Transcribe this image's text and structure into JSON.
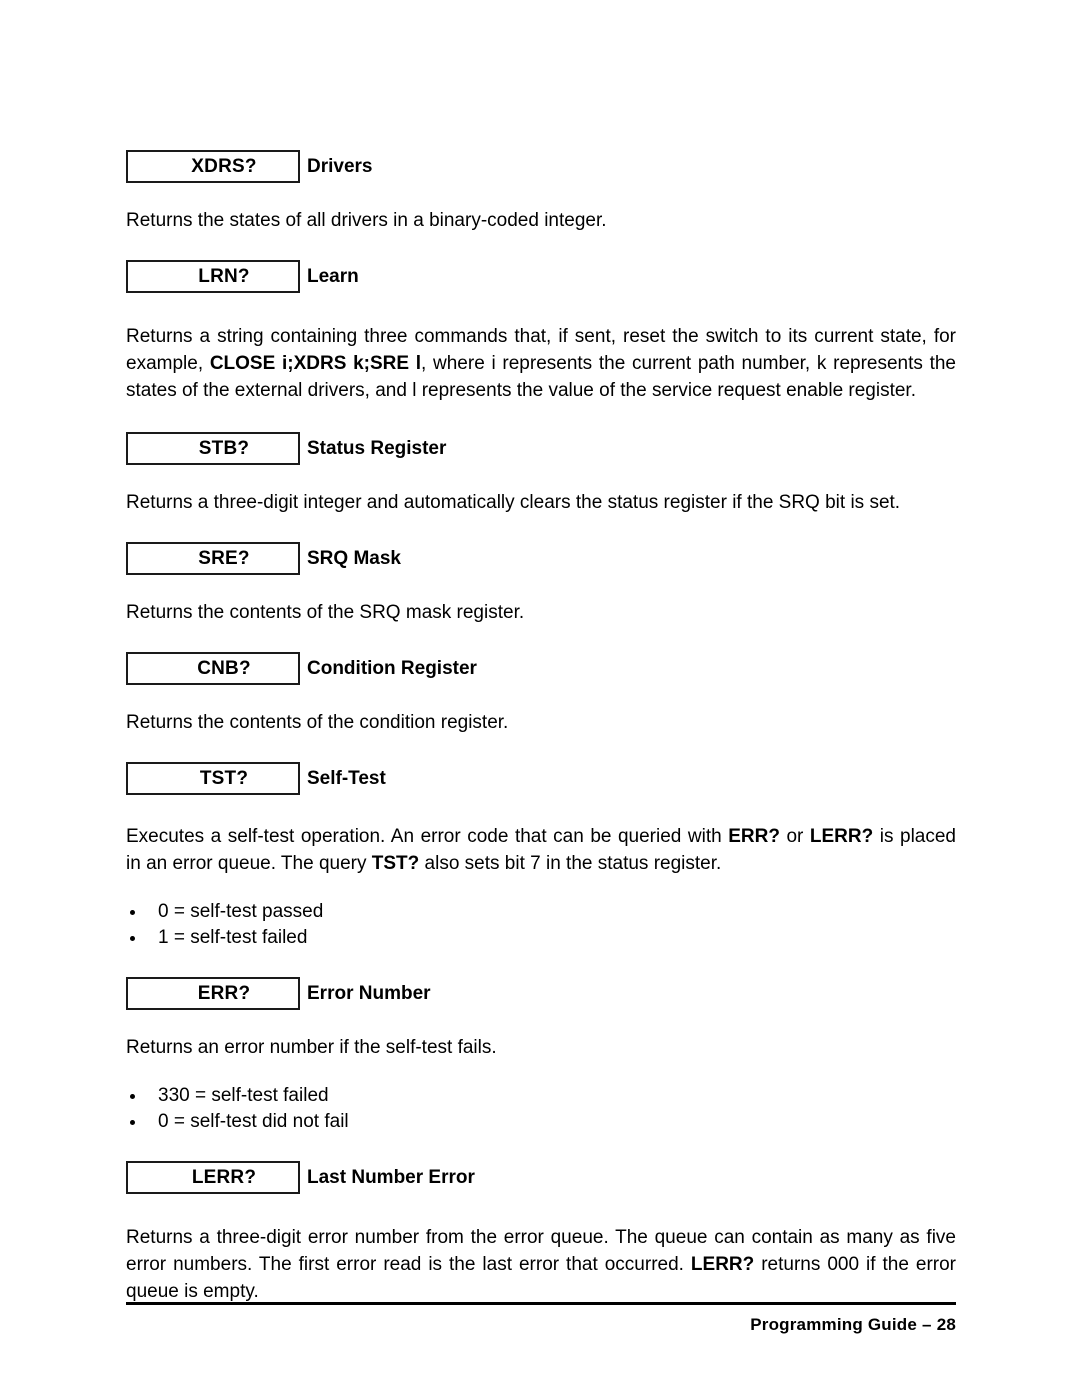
{
  "document": {
    "sections": [
      {
        "command": "XDRS?",
        "title": "Drivers",
        "paragraph": "Returns the states of all drivers in a binary-coded integer."
      },
      {
        "command": "LRN?",
        "title": "Learn",
        "paragraph_part1": "Returns a string containing three commands that, if sent, reset the switch to its current state, for example, ",
        "paragraph_bold": "CLOSE i;XDRS k;SRE l",
        "paragraph_part2": ", where i represents the current path number, k represents the states of the external drivers, and l represents the value of the service request enable register."
      },
      {
        "command": "STB?",
        "title": "Status Register",
        "paragraph": "Returns a three-digit integer and automatically clears the status register if the SRQ bit is set."
      },
      {
        "command": "SRE?",
        "title": "SRQ Mask",
        "paragraph": "Returns the contents of the SRQ mask register."
      },
      {
        "command": "CNB?",
        "title": "Condition Register",
        "paragraph": "Returns the contents of the condition register."
      },
      {
        "command": "TST?",
        "title": "Self-Test",
        "paragraph_part1": "Executes a self-test operation. An error code that can be queried with ",
        "paragraph_bold1": "ERR?",
        "paragraph_part2": " or ",
        "paragraph_bold2": "LERR?",
        "paragraph_part3": " is placed in an error queue. The query ",
        "paragraph_bold3": "TST?",
        "paragraph_part4": " also sets bit 7 in the status register.",
        "bullets": [
          "0 = self-test passed",
          "1 = self-test failed"
        ]
      },
      {
        "command": "ERR?",
        "title": "Error Number",
        "paragraph": "Returns an error number if the self-test fails.",
        "bullets": [
          "330 = self-test failed",
          "0 = self-test did not fail"
        ]
      },
      {
        "command": "LERR?",
        "title": "Last Number Error",
        "paragraph_part1": "Returns a three-digit error number from the error queue. The queue can contain as many as five error numbers. The first error read is the last error that occurred. ",
        "paragraph_bold": "LERR?",
        "paragraph_part2": " returns 000 if the error queue is empty."
      }
    ]
  },
  "footer": {
    "title": "Programming Guide",
    "separator": "–",
    "page_number": "28"
  }
}
